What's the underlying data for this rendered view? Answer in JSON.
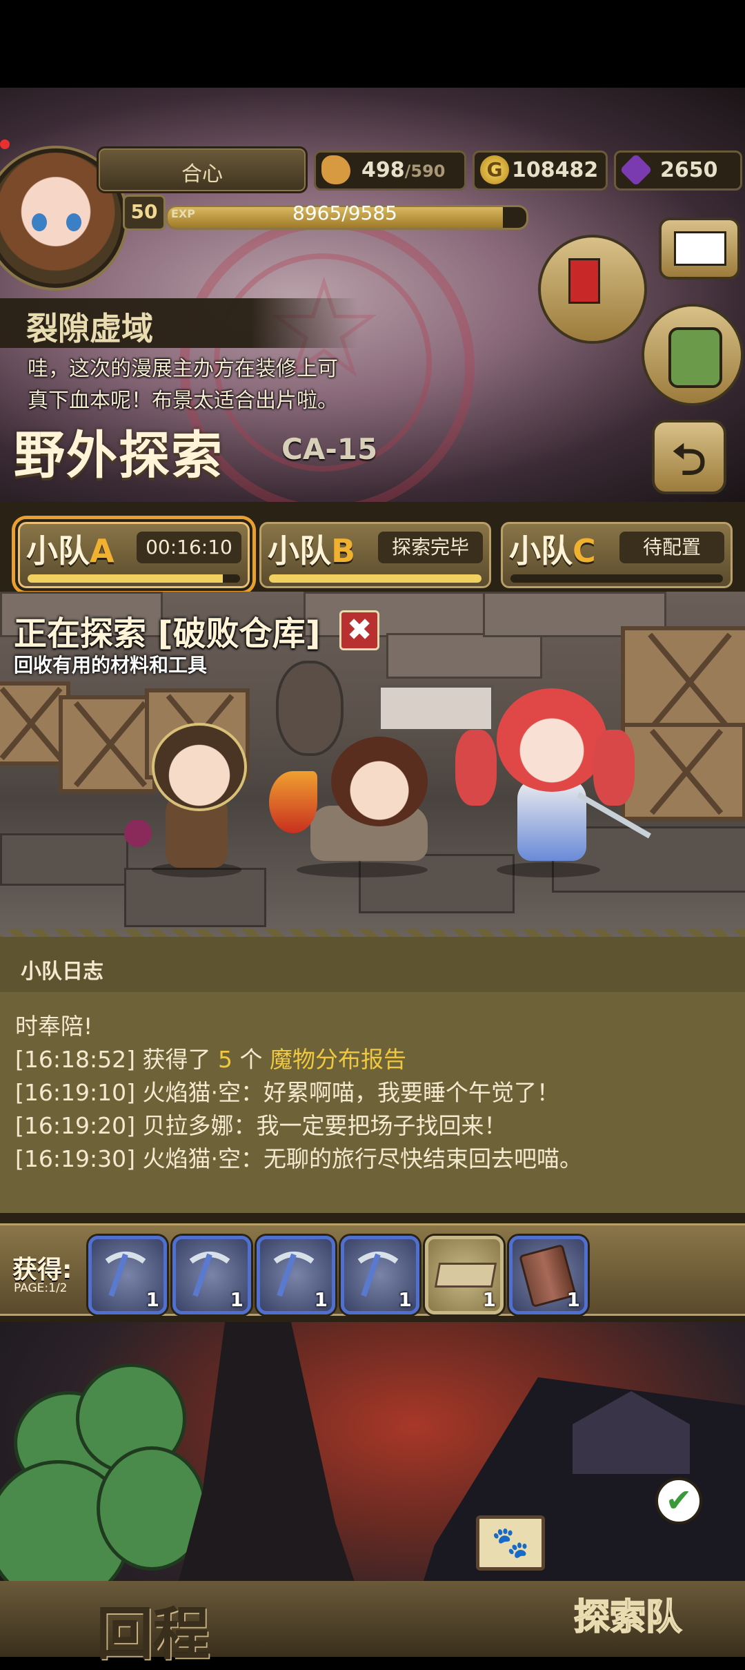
{
  "header": {
    "player_name": "合心",
    "level": "50",
    "exp_tag": "EXP",
    "exp_text": "8965/9585",
    "exp_fraction": 0.935,
    "stamina_current": "498",
    "stamina_max": "/590",
    "gold": "108482",
    "gems": "2650",
    "icons": [
      "bread-icon",
      "gold-coin-icon",
      "purple-gem-icon",
      "mail-icon",
      "quest-scroll-icon",
      "backpack-icon"
    ]
  },
  "zone": {
    "name": "裂隙虚域",
    "story_line1": "哇，这次的漫展主办方在装修上可",
    "story_line2": "真下血本呢！布景太适合出片啦。",
    "mode_title": "野外探索",
    "stage_code": "CA-15",
    "back_glyph": "⮌"
  },
  "squads": [
    {
      "prefix": "小队",
      "letter": "A",
      "status": "00:16:10",
      "progress": 0.92,
      "active": true
    },
    {
      "prefix": "小队",
      "letter": "B",
      "status": "探索完毕",
      "progress": 1.0,
      "active": false
    },
    {
      "prefix": "小队",
      "letter": "C",
      "status": "待配置",
      "progress": 0.0,
      "active": false
    }
  ],
  "exploration": {
    "title": "正在探索 [破败仓库]",
    "cancel_glyph": "✖",
    "description": "回收有用的材料和工具"
  },
  "log": {
    "title": "小队日志",
    "lines": [
      {
        "ts": "",
        "text": "时奉陪!"
      },
      {
        "ts": "[16:18:52]",
        "pre": "获得了 ",
        "hl1": "5",
        "mid": " 个 ",
        "hl2": "魔物分布报告"
      },
      {
        "ts": "[16:19:10]",
        "text": "火焰猫·空：好累啊喵，我要睡个午觉了！"
      },
      {
        "ts": "[16:19:20]",
        "text": "贝拉多娜：我一定要把场子找回来！"
      },
      {
        "ts": "[16:19:30]",
        "text": "火焰猫·空：无聊的旅行尽快结束回去吧喵。"
      }
    ]
  },
  "rewards": {
    "label": "获得:",
    "page": "PAGE:1/2",
    "items": [
      {
        "icon": "pickaxe-icon",
        "qty": "1"
      },
      {
        "icon": "pickaxe-icon",
        "qty": "1"
      },
      {
        "icon": "pickaxe-icon",
        "qty": "1"
      },
      {
        "icon": "pickaxe-icon",
        "qty": "1"
      },
      {
        "icon": "wood-plank-icon",
        "qty": "1"
      },
      {
        "icon": "bark-piece-icon",
        "qty": "1"
      }
    ]
  },
  "bottom": {
    "return_label": "回程",
    "explore_team_label": "探索队",
    "check_glyph": "✔",
    "paw_glyph": "🐾"
  },
  "colors": {
    "accent_orange": "#e8a030",
    "highlight_yellow": "#f0c840",
    "rare_blue": "#5070d0",
    "cancel_red": "#b83030"
  }
}
